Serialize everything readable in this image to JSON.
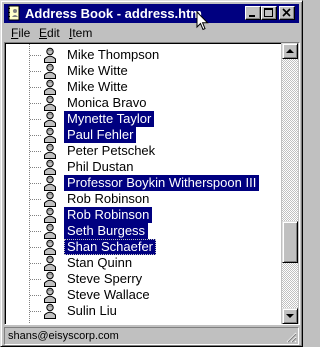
{
  "window": {
    "title": "Address Book - address.htm"
  },
  "menu": {
    "items": [
      {
        "label": "File",
        "access_key": "F",
        "rest": "ile"
      },
      {
        "label": "Edit",
        "access_key": "E",
        "rest": "dit"
      },
      {
        "label": "Item",
        "access_key": "I",
        "rest": "tem"
      }
    ]
  },
  "contacts": [
    {
      "name": "Mike Thompson",
      "selected": false
    },
    {
      "name": "Mike Witte",
      "selected": false
    },
    {
      "name": "Mike Witte",
      "selected": false
    },
    {
      "name": "Monica Bravo",
      "selected": false
    },
    {
      "name": "Mynette Taylor",
      "selected": true
    },
    {
      "name": "Paul Fehler",
      "selected": true
    },
    {
      "name": "Peter Petschek",
      "selected": false
    },
    {
      "name": "Phil Dustan",
      "selected": false
    },
    {
      "name": "Professor Boykin Witherspoon III",
      "selected": true
    },
    {
      "name": "Rob Robinson",
      "selected": false
    },
    {
      "name": "Rob Robinson",
      "selected": true
    },
    {
      "name": "Seth Burgess",
      "selected": true
    },
    {
      "name": "Shan Schaefer",
      "selected": true,
      "focused": true
    },
    {
      "name": "Stan Quinn",
      "selected": false
    },
    {
      "name": "Steve Sperry",
      "selected": false
    },
    {
      "name": "Steve Wallace",
      "selected": false
    },
    {
      "name": "Sulin Liu",
      "selected": false
    }
  ],
  "status": {
    "text": "shans@eisyscorp.com"
  },
  "colors": {
    "titlebar": "#000080",
    "selection": "#000080",
    "chrome": "#c0c0c0"
  }
}
